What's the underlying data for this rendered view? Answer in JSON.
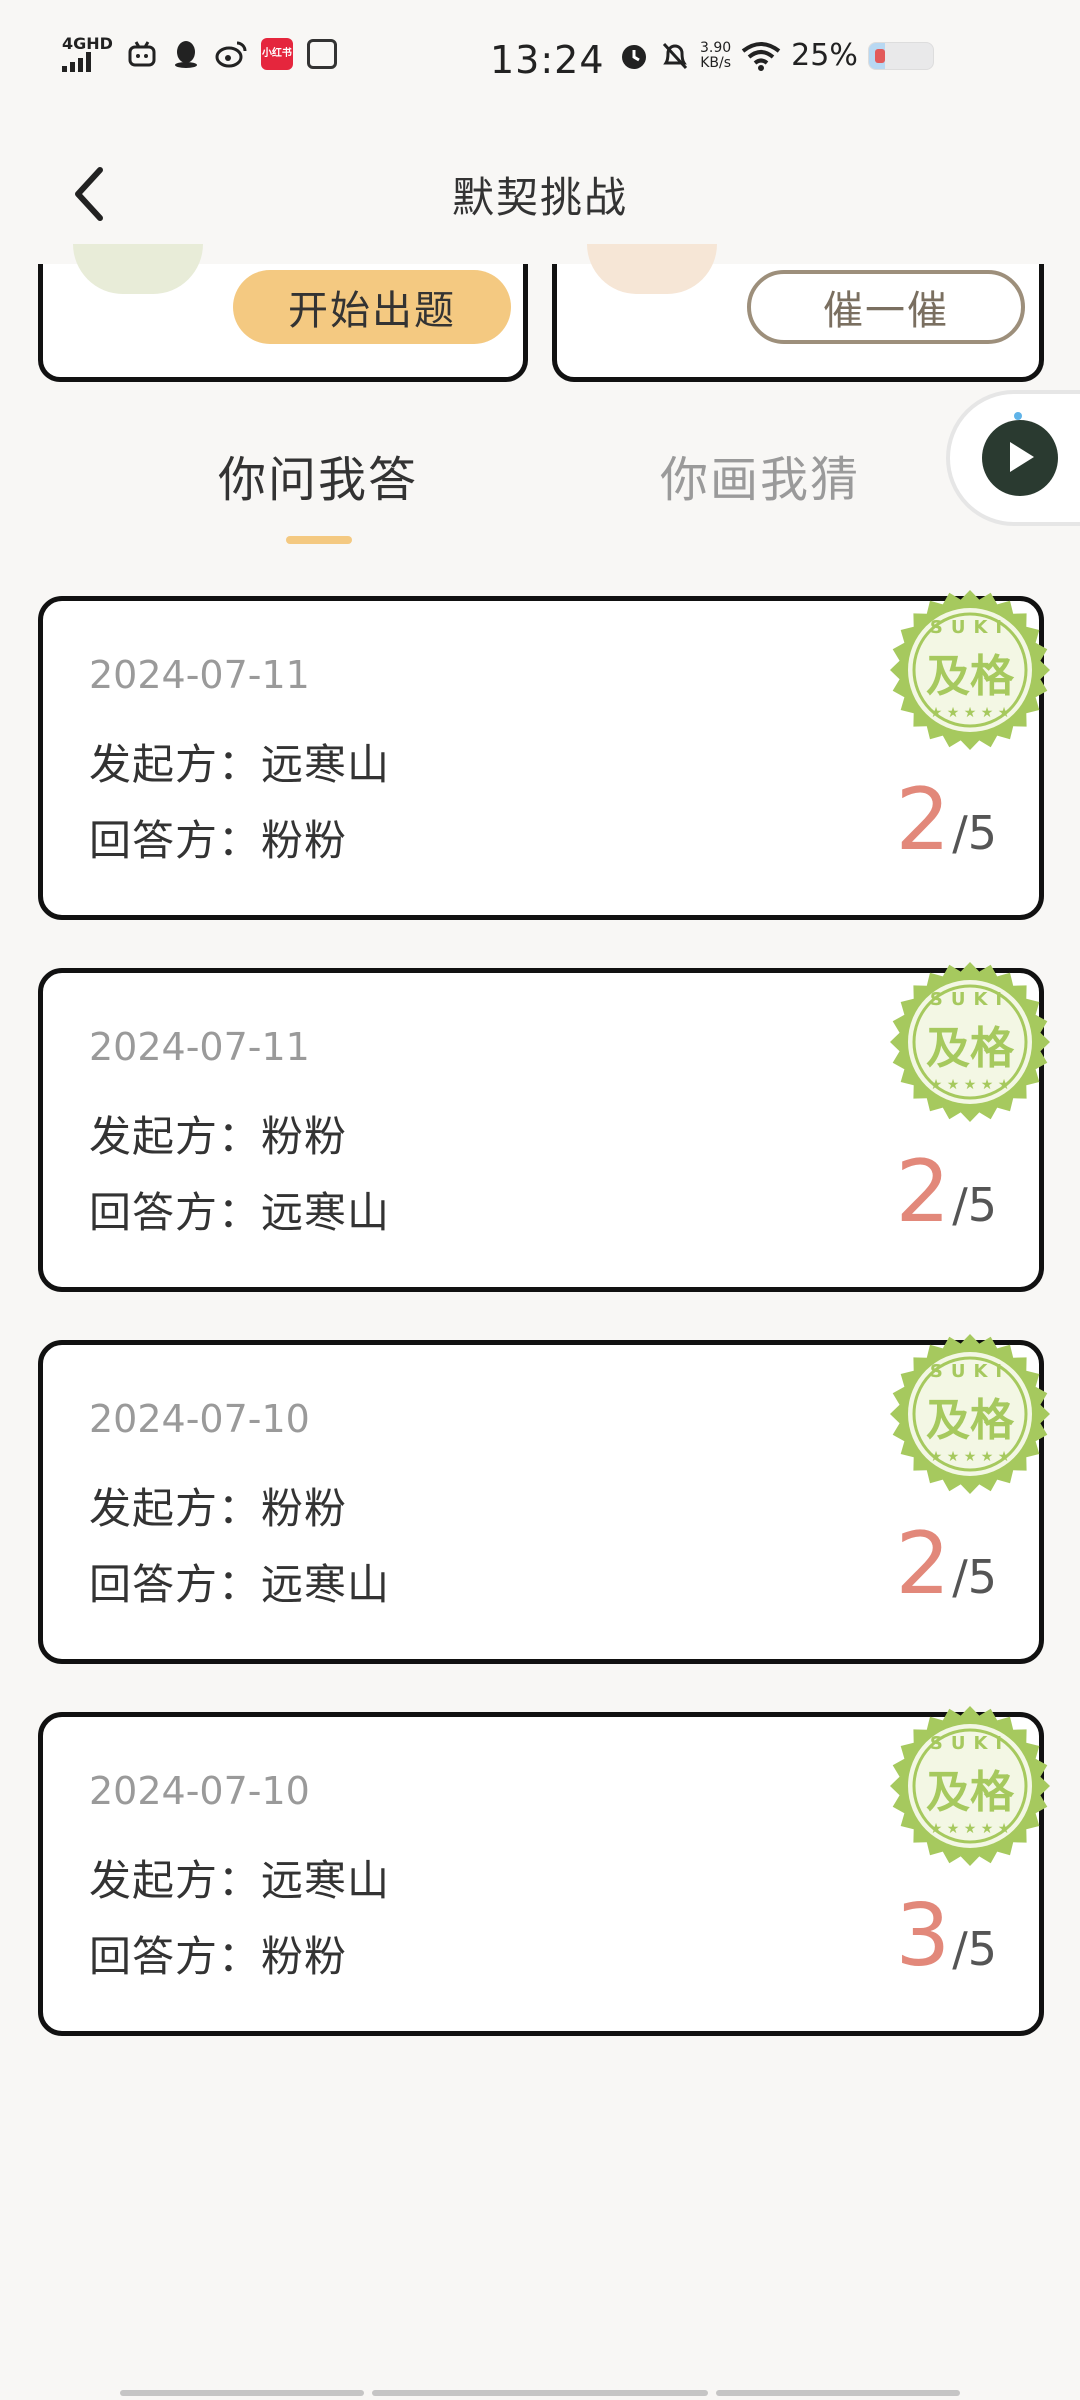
{
  "status_bar": {
    "network": "4GHD",
    "time": "13:24",
    "speed_value": "3.90",
    "speed_unit": "KB/s",
    "battery_percent": "25%",
    "battery_level": 0.25,
    "red_app_label": "小红书"
  },
  "header": {
    "title": "默契挑战"
  },
  "top_cards": {
    "start_button": "开始出题",
    "urge_button": "催一催"
  },
  "tabs": [
    {
      "label": "你问我答",
      "active": true
    },
    {
      "label": "你画我猜",
      "active": false
    }
  ],
  "records": [
    {
      "date": "2024-07-11",
      "initiator_label": "发起方：",
      "initiator": "远寒山",
      "answerer_label": "回答方：",
      "answerer": "粉粉",
      "score": "2",
      "total": "/5",
      "stamp_top": "SUKI",
      "stamp_main": "及格"
    },
    {
      "date": "2024-07-11",
      "initiator_label": "发起方：",
      "initiator": "粉粉",
      "answerer_label": "回答方：",
      "answerer": "远寒山",
      "score": "2",
      "total": "/5",
      "stamp_top": "SUKI",
      "stamp_main": "及格"
    },
    {
      "date": "2024-07-10",
      "initiator_label": "发起方：",
      "initiator": "粉粉",
      "answerer_label": "回答方：",
      "answerer": "远寒山",
      "score": "2",
      "total": "/5",
      "stamp_top": "SUKI",
      "stamp_main": "及格"
    },
    {
      "date": "2024-07-10",
      "initiator_label": "发起方：",
      "initiator": "远寒山",
      "answerer_label": "回答方：",
      "answerer": "粉粉",
      "score": "3",
      "total": "/5",
      "stamp_top": "SUKI",
      "stamp_main": "及格"
    }
  ],
  "colors": {
    "accent": "#f4c981",
    "score": "#e2887a",
    "stamp": "#a6c95e",
    "background": "#f8f7f5"
  },
  "icons": {
    "back": "chevron-left-icon",
    "float": "play-icon"
  }
}
